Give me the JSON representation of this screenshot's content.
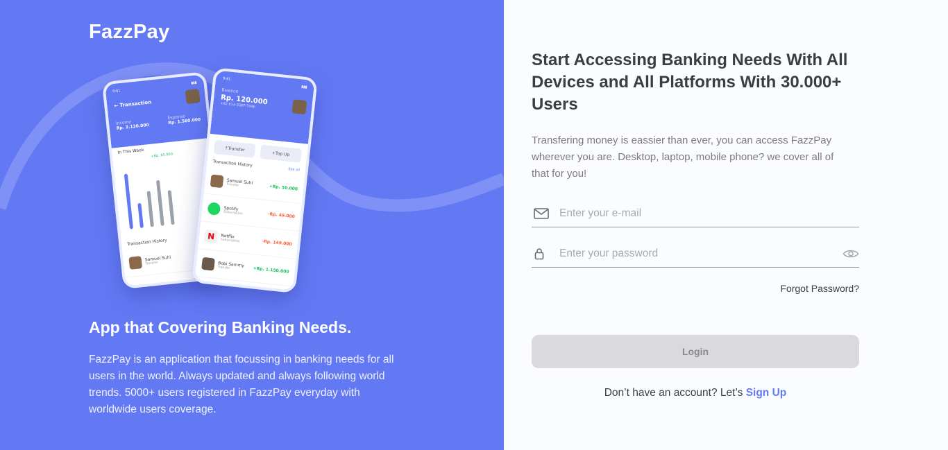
{
  "brand": "FazzPay",
  "left": {
    "title": "App that Covering Banking Needs.",
    "description": "FazzPay is an application that focussing in banking needs for all users in the world. Always updated and always following world trends. 5000+ users registered in FazzPay everyday with worldwide users coverage."
  },
  "phone1": {
    "time": "9:41",
    "header": "Transaction",
    "income_label": "Income",
    "income": "Rp. 2.120.000",
    "expense_label": "Expense",
    "expense": "Rp. 1.560.000",
    "week_label": "In This Week",
    "bubble": "+Rp. 65.000",
    "history_label": "Transaction History",
    "tx_name": "Samuel Suhi",
    "tx_type": "Transfer"
  },
  "phone2": {
    "time": "9:41",
    "balance_label": "Balance",
    "balance": "Rp. 120.000",
    "phone": "+62 813-9387-7946",
    "transfer": "Transfer",
    "topup": "Top Up",
    "history_label": "Transaction History",
    "see_all": "See all",
    "transactions": [
      {
        "name": "Samuel Suhi",
        "type": "Transfer",
        "amount": "+Rp. 50.000",
        "sign": "pos"
      },
      {
        "name": "Spotify",
        "type": "Subscription",
        "amount": "-Rp. 49.000",
        "sign": "neg"
      },
      {
        "name": "Netflix",
        "type": "Subscription",
        "amount": "-Rp. 149.000",
        "sign": "neg"
      },
      {
        "name": "Bobi Sammy",
        "type": "Transfer",
        "amount": "+Rp. 1.150.000",
        "sign": "pos"
      }
    ]
  },
  "right": {
    "title": "Start Accessing Banking Needs With All Devices and All Platforms With 30.000+ Users",
    "description": "Transfering money is eassier than ever, you can access FazzPay wherever you are. Desktop, laptop, mobile phone? we cover all of that for you!",
    "email_placeholder": "Enter your e-mail",
    "password_placeholder": "Enter your password",
    "forgot": "Forgot Password?",
    "login": "Login",
    "signup_prompt": "Don’t have an account? Let’s",
    "signup_link": "Sign Up"
  },
  "colors": {
    "primary": "#6379f4",
    "text_dark": "#3a3d42",
    "text_muted": "#7b7a80",
    "button_disabled": "#dadadc"
  },
  "icons": [
    "mail-icon",
    "lock-icon",
    "eye-icon"
  ]
}
